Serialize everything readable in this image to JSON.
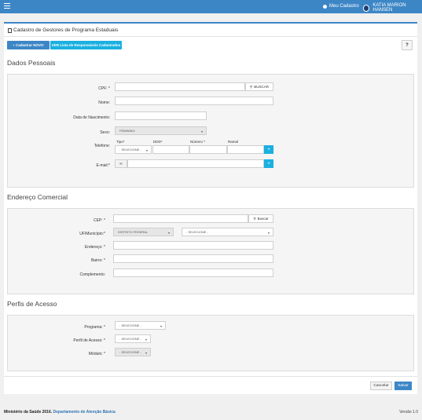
{
  "topbar": {
    "meu_cadastro": "Meu Cadastro",
    "user_name": "KATIA MARION HANSEN"
  },
  "page": {
    "title": "Cadastro de Gestores de Programa Estaduais"
  },
  "actions": {
    "new": "Cadastrar NOVO",
    "list": "VER Lista de Responsáveis Cadastrados",
    "help": "?"
  },
  "dados": {
    "title": "Dados Pessoais",
    "cpf_label": "CPF: *",
    "buscar": "BUSCAR",
    "nome_label": "Nome:",
    "nascimento_label": "Data de Nascimento:",
    "sexo_label": "Sexo:",
    "sexo_value": "FEMININO",
    "telefone_label": "Telefone:",
    "tipo_label": "Tipo*",
    "ddd_label": "DDD*",
    "numero_label": "Número *",
    "ramal_label": "Ramal",
    "tipo_value": "- SELECIONE -",
    "email_label": "E-mail:*",
    "plus": "+"
  },
  "endereco": {
    "title": "Endereço Comercial",
    "cep_label": "CEP: *",
    "buscar": "Buscar",
    "uf_label": "UF/Município:*",
    "uf_value": "DISTRITO FEDERAL",
    "municipio_value": "- SELECIONE -",
    "endereco_label": "Endereço: *",
    "bairro_label": "Bairro: *",
    "complemento_label": "Complemento:"
  },
  "perfis": {
    "title": "Perfis de Acesso",
    "programa_label": "Programa: *",
    "programa_value": "- SELECIONE -",
    "perfil_label": "Perfil de Acesso: *",
    "perfil_value": "- SELECIONE -",
    "modulo_label": "Módulo: *",
    "modulo_value": "- SELECIONE -"
  },
  "form": {
    "cancel": "Cancelar",
    "save": "Salvar"
  },
  "footer": {
    "ministry": "Ministério da Saúde 2016.",
    "dept": "Departamento de Atenção Básica",
    "version": "Versão 1.0"
  }
}
